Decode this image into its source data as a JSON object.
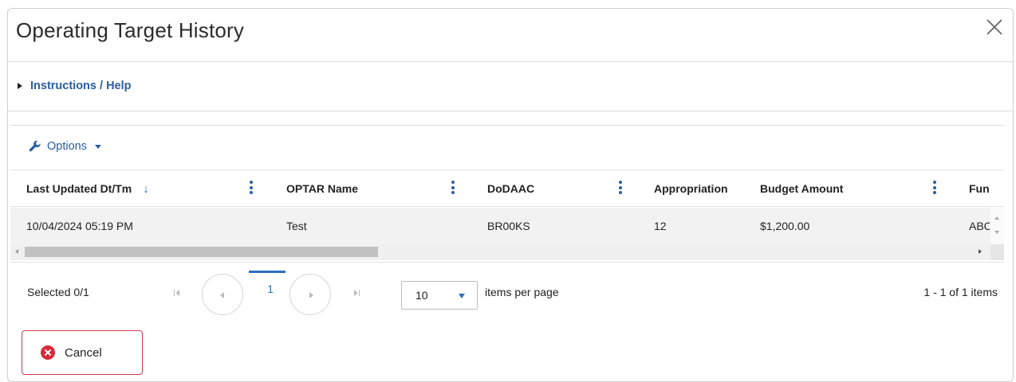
{
  "dialog": {
    "title": "Operating Target History"
  },
  "instructions": {
    "label": "Instructions / Help"
  },
  "toolbar": {
    "options_label": "Options"
  },
  "grid": {
    "columns": [
      {
        "label": "Last Updated Dt/Tm"
      },
      {
        "label": "OPTAR Name"
      },
      {
        "label": "DoDAAC"
      },
      {
        "label": "Appropriation"
      },
      {
        "label": "Budget Amount"
      },
      {
        "label": "Fun"
      }
    ],
    "rows": [
      {
        "last_updated": "10/04/2024 05:19 PM",
        "optar_name": "Test",
        "dodaac": "BR00KS",
        "appropriation": "12",
        "budget_amount": "$1,200.00",
        "fund": "ABC"
      }
    ]
  },
  "pager": {
    "selected": "Selected 0/1",
    "current_page": "1",
    "page_size": "10",
    "per_page_label": "items per page",
    "range": "1 - 1 of 1 items"
  },
  "footer": {
    "cancel_label": "Cancel"
  },
  "colors": {
    "link": "#2a5ea0",
    "accent": "#2a6fc0",
    "danger": "#d8293b"
  }
}
